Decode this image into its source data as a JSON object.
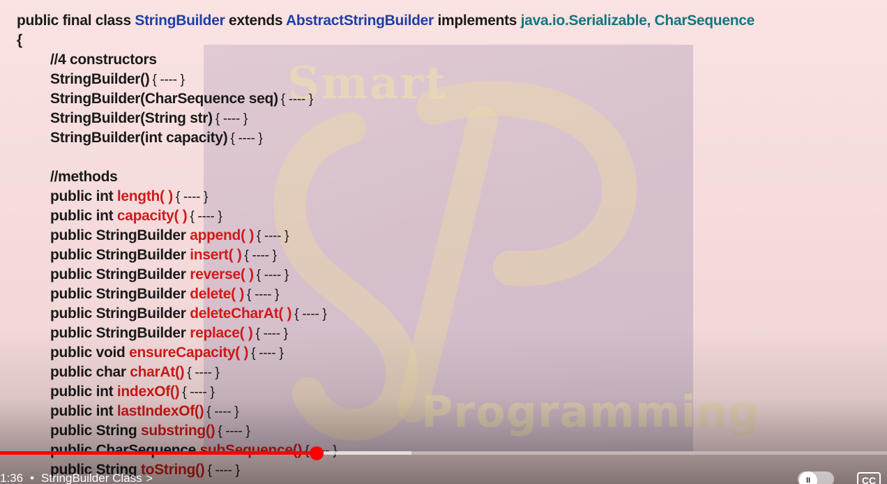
{
  "code": {
    "class_decl": {
      "prefix": "public final class ",
      "class_name": "StringBuilder",
      "extends_kw": " extends ",
      "parent": "AbstractStringBuilder",
      "implements_kw": " implements ",
      "interfaces": "java.io.Serializable, CharSequence"
    },
    "open_brace": "{",
    "constructors_comment": "//4 constructors",
    "constructors": [
      {
        "sig": "StringBuilder()",
        "body": "{ ---- }"
      },
      {
        "sig": "StringBuilder(CharSequence seq)",
        "body": "{ ---- }"
      },
      {
        "sig": "StringBuilder(String str)",
        "body": "{ ---- }"
      },
      {
        "sig": "StringBuilder(int capacity)",
        "body": "{ ---- }"
      }
    ],
    "methods_comment": "//methods",
    "methods": [
      {
        "ret": "public int ",
        "name": "length( )",
        "body": "{ ---- }"
      },
      {
        "ret": "public int ",
        "name": "capacity( )",
        "body": "{ ---- }"
      },
      {
        "ret": "public StringBuilder ",
        "name": "append( )",
        "body": "{ ---- }"
      },
      {
        "ret": "public StringBuilder ",
        "name": "insert( )",
        "body": "{ ---- }"
      },
      {
        "ret": "public StringBuilder ",
        "name": "reverse( )",
        "body": "{ ---- }"
      },
      {
        "ret": "public StringBuilder ",
        "name": "delete( )",
        "body": "{ ---- }"
      },
      {
        "ret": "public StringBuilder ",
        "name": "deleteCharAt( )",
        "body": "{ ---- }"
      },
      {
        "ret": "public StringBuilder ",
        "name": "replace( )",
        "body": "{ ---- }"
      },
      {
        "ret": "public void ",
        "name": "ensureCapacity( )",
        "body": "{ ---- }"
      },
      {
        "ret": "public char ",
        "name": "charAt()",
        "body": "{ ---- }"
      },
      {
        "ret": "public int ",
        "name": "indexOf()",
        "body": "{ ---- }"
      },
      {
        "ret": "public int ",
        "name": "lastIndexOf()",
        "body": "{ ---- }"
      },
      {
        "ret": "public String ",
        "name": "substring()",
        "body": "{ ---- }"
      },
      {
        "ret": "public CharSequence ",
        "name": "subSequence()",
        "body": "{ ---- }"
      },
      {
        "ret": "public String ",
        "name": "toString()",
        "body": "{ ---- }"
      }
    ]
  },
  "watermark": {
    "top_text": "Smart",
    "bottom_text": "Programming"
  },
  "player": {
    "current_time": "1:36",
    "separator": "•",
    "chapter_title": "StringBuilder Class",
    "chapter_chevron": ">",
    "progress_played_fraction": 0.357,
    "progress_buffered_fraction": 0.464,
    "autoplay_label": "II",
    "cc_label": "CC",
    "accent_color": "#ff0000"
  },
  "colors": {
    "keyword_text": "#1a1a1a",
    "method_name": "#d11a1a",
    "class_name": "#1e3fa8",
    "interfaces": "#14767d"
  }
}
